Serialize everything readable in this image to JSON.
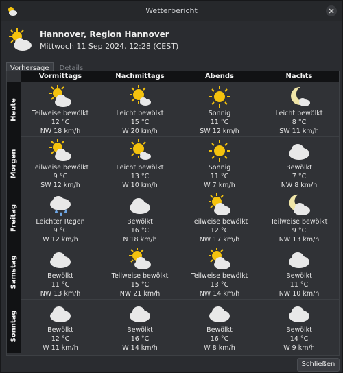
{
  "window": {
    "title": "Wetterbericht"
  },
  "header": {
    "location": "Hannover, Region Hannover",
    "datetime": "Mittwoch 11 Sep 2024, 12:28 (CEST)",
    "icon": "partly-cloudy-icon"
  },
  "tabs": [
    {
      "label": "Vorhersage",
      "active": true
    },
    {
      "label": "Details",
      "active": false
    }
  ],
  "columns": [
    "Vormittags",
    "Nachmittags",
    "Abends",
    "Nachts"
  ],
  "rows": [
    {
      "day": "Heute",
      "cells": [
        {
          "icon": "partly-cloudy-day",
          "desc": "Teilweise bewölkt",
          "temp": "12 °C",
          "wind": "NW 18 km/h"
        },
        {
          "icon": "sun-cloud-small",
          "desc": "Leicht bewölkt",
          "temp": "15 °C",
          "wind": "W 20 km/h"
        },
        {
          "icon": "sun",
          "desc": "Sonnig",
          "temp": "11 °C",
          "wind": "SW 12 km/h"
        },
        {
          "icon": "moon-cloud-small",
          "desc": "Leicht bewölkt",
          "temp": "8 °C",
          "wind": "SW 11 km/h"
        }
      ]
    },
    {
      "day": "Morgen",
      "cells": [
        {
          "icon": "partly-cloudy-day",
          "desc": "Teilweise bewölkt",
          "temp": "9 °C",
          "wind": "SW 12 km/h"
        },
        {
          "icon": "sun-cloud-small",
          "desc": "Leicht bewölkt",
          "temp": "13 °C",
          "wind": "W 10 km/h"
        },
        {
          "icon": "sun",
          "desc": "Sonnig",
          "temp": "11 °C",
          "wind": "W 7 km/h"
        },
        {
          "icon": "cloud",
          "desc": "Bewölkt",
          "temp": "7 °C",
          "wind": "NW 8 km/h"
        }
      ]
    },
    {
      "day": "Freitag",
      "cells": [
        {
          "icon": "rain",
          "desc": "Leichter Regen",
          "temp": "9 °C",
          "wind": "W 12 km/h"
        },
        {
          "icon": "cloud",
          "desc": "Bewölkt",
          "temp": "16 °C",
          "wind": "N 18 km/h"
        },
        {
          "icon": "partly-cloudy-day",
          "desc": "Teilweise bewölkt",
          "temp": "12 °C",
          "wind": "NW 17 km/h"
        },
        {
          "icon": "partly-cloudy-night",
          "desc": "Teilweise bewölkt",
          "temp": "9 °C",
          "wind": "NW 13 km/h"
        }
      ]
    },
    {
      "day": "Samstag",
      "cells": [
        {
          "icon": "cloud",
          "desc": "Bewölkt",
          "temp": "11 °C",
          "wind": "NW 13 km/h"
        },
        {
          "icon": "partly-cloudy-day",
          "desc": "Teilweise bewölkt",
          "temp": "15 °C",
          "wind": "NW 21 km/h"
        },
        {
          "icon": "partly-cloudy-day",
          "desc": "Teilweise bewölkt",
          "temp": "13 °C",
          "wind": "NW 14 km/h"
        },
        {
          "icon": "cloud",
          "desc": "Bewölkt",
          "temp": "11 °C",
          "wind": "NW 10 km/h"
        }
      ]
    },
    {
      "day": "Sonntag",
      "cells": [
        {
          "icon": "cloud",
          "desc": "Bewölkt",
          "temp": "12 °C",
          "wind": "W 11 km/h"
        },
        {
          "icon": "cloud",
          "desc": "Bewölkt",
          "temp": "16 °C",
          "wind": "W 14 km/h"
        },
        {
          "icon": "cloud",
          "desc": "Bewölkt",
          "temp": "16 °C",
          "wind": "W 8 km/h"
        },
        {
          "icon": "cloud",
          "desc": "Bewölkt",
          "temp": "14 °C",
          "wind": "W 9 km/h"
        }
      ]
    }
  ],
  "footer": {
    "close_label": "Schließen"
  },
  "colors": {
    "sun": "#f4c20d",
    "cloud": "#e8e8e8",
    "moon": "#f0e6a8"
  }
}
